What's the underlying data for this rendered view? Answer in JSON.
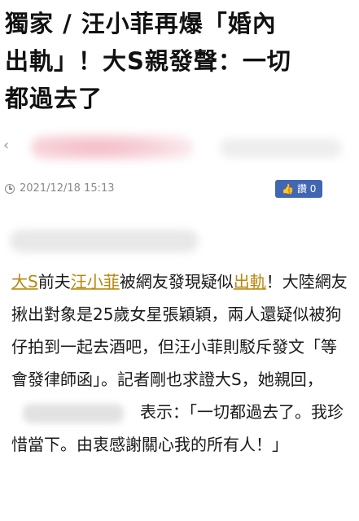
{
  "headline": {
    "line1": "獨家 / 汪小菲再爆「婚內",
    "line2": "出軌」！大S親發聲：一切",
    "line3": "都過去了"
  },
  "meta": {
    "date": "2021/12/18 15:13",
    "like_label": "讚 0"
  },
  "article": {
    "p1_link1": "大S",
    "p1_t1": "前夫",
    "p1_link2": "汪小菲",
    "p1_t2": "被網友發現疑似",
    "p1_link3": "出軌",
    "p1_t3": "！大陸網友揪出對象是25歲女星張穎穎，兩人還疑似被狗仔拍到一起去酒吧，但汪小菲則駁斥發文「等會發律師函」。記者剛也求證大S，她親回，",
    "p1_t4": "表示：「一切都過去了。我珍惜當下。由衷感謝關心我的所有人！」"
  },
  "colors": {
    "link": "#b8860b",
    "like_button": "#4267b2",
    "meta_text": "#8a8a8a"
  },
  "icons": {
    "clock": "clock-icon",
    "like": "thumbs-up-icon"
  }
}
